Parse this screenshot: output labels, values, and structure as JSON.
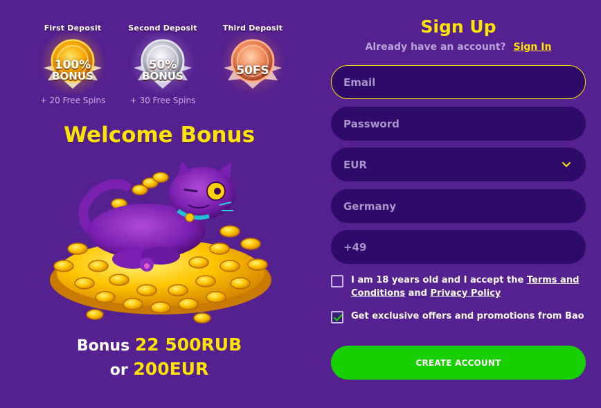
{
  "badges": [
    {
      "caption": "First Deposit",
      "line1": "100%",
      "line2": "BONUS",
      "spins": "+ 20 Free Spins",
      "tier": "gold",
      "color": "#f5a800"
    },
    {
      "caption": "Second Deposit",
      "line1": "50%",
      "line2": "BONUS",
      "spins": "+ 30 Free Spins",
      "tier": "silver",
      "color": "#b8b8c8"
    },
    {
      "caption": "Third Deposit",
      "line1": "50FS",
      "line2": "",
      "spins": "",
      "tier": "bronze",
      "color": "#f08a5a"
    }
  ],
  "welcome": {
    "title": "Welcome Bonus",
    "mascot_icon": "cat-on-gold-coins-illustration",
    "bonus_prefix": "Bonus",
    "bonus_amount_rub": "22 500RUB",
    "bonus_or": "or",
    "bonus_amount_eur": "200EUR"
  },
  "signup": {
    "title": "Sign Up",
    "have_account": "Already have an account?",
    "signin_link": "Sign In",
    "email_placeholder": "Email",
    "password_placeholder": "Password",
    "currency_value": "EUR",
    "country_value": "Germany",
    "phone_prefix": "+49",
    "age_text_before": "I am 18 years old and I accept the",
    "terms_link": "Terms and Conditions",
    "age_and": "and",
    "privacy_link": "Privacy Policy",
    "age_checked": false,
    "offers_text": "Get exclusive offers and promotions from Bao",
    "offers_checked": true,
    "create_button": "CREATE ACCOUNT"
  },
  "colors": {
    "background": "#55208f",
    "field_bg": "#2e0b6a",
    "accent_yellow": "#ffe400",
    "button_green": "#18d000"
  }
}
